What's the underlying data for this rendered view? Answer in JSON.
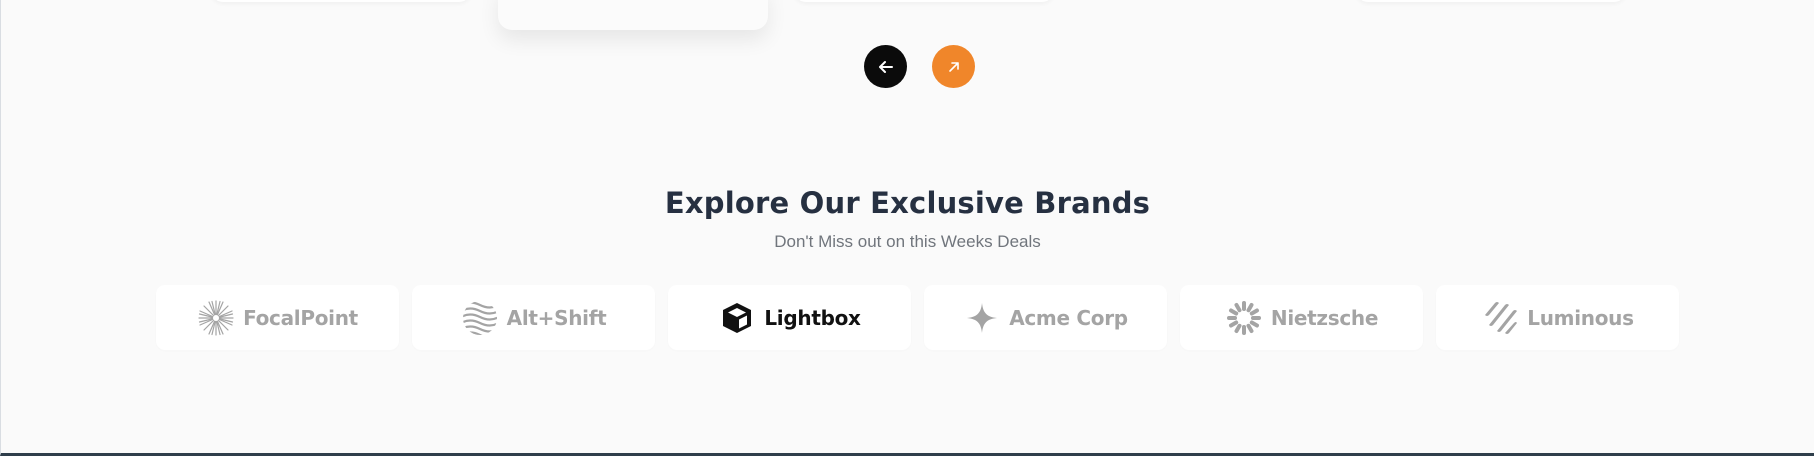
{
  "carousel": {
    "prev_icon": "arrow-left-icon",
    "next_icon": "arrow-up-right-icon",
    "prev_color": "#0b0b0b",
    "next_color": "#f0862a"
  },
  "brands_section": {
    "title": "Explore Our Exclusive Brands",
    "subtitle": "Don't Miss out on this Weeks Deals",
    "brands": [
      {
        "name": "FocalPoint",
        "icon": "sunburst-icon",
        "active": false
      },
      {
        "name": "Alt+Shift",
        "icon": "waves-icon",
        "active": false
      },
      {
        "name": "Lightbox",
        "icon": "cube-icon",
        "active": true
      },
      {
        "name": "Acme Corp",
        "icon": "sparkle-icon",
        "active": false
      },
      {
        "name": "Nietzsche",
        "icon": "spinner-icon",
        "active": false
      },
      {
        "name": "Luminous",
        "icon": "stripes-icon",
        "active": false
      }
    ]
  },
  "colors": {
    "background": "#fafafa",
    "heading": "#263041",
    "subtitle": "#70757c",
    "brand_inactive": "#a4a4a4",
    "brand_active": "#111111"
  }
}
